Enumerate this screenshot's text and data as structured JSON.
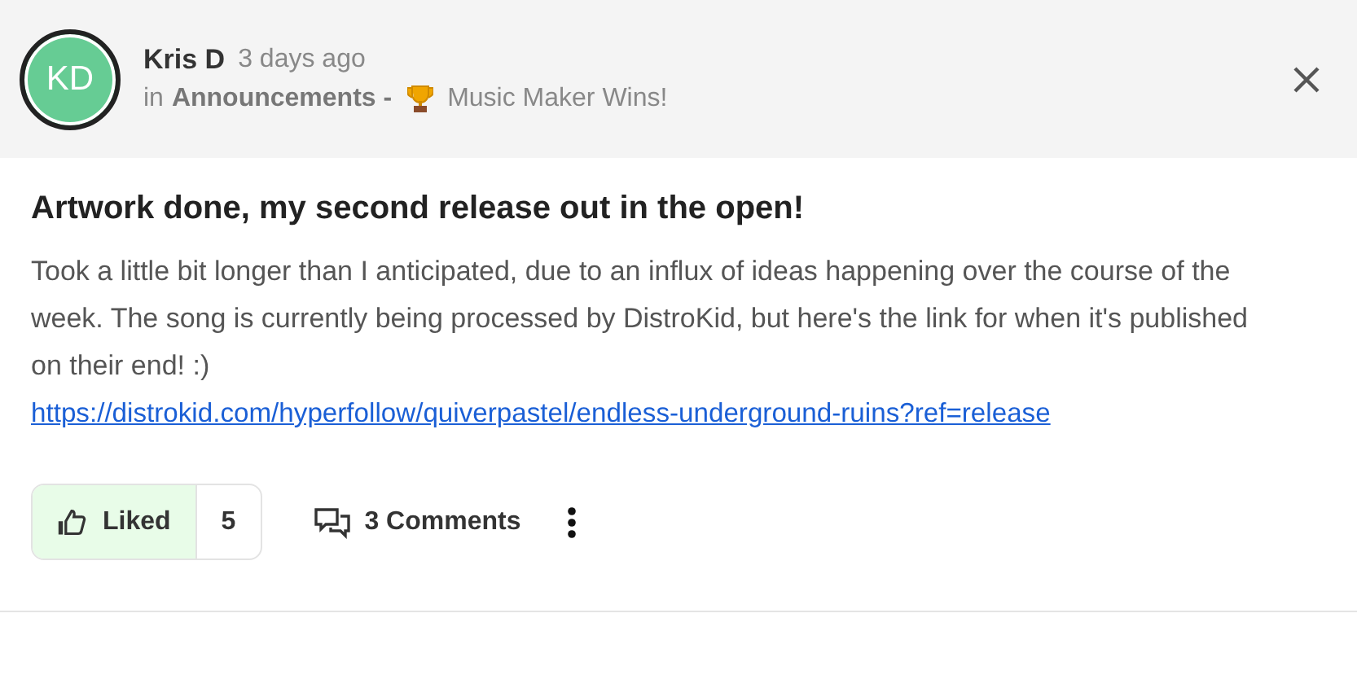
{
  "post": {
    "author": "Kris D",
    "avatar": {
      "initials": "KD",
      "color": "#66cc94"
    },
    "time": "3 days ago",
    "in_label": "in",
    "category": "Announcements -",
    "topic": "Music Maker Wins!",
    "title": "Artwork done, my second release out in the open!",
    "body": "Took a little bit longer than I anticipated, due to an influx of ideas happening over the course of the week. The song is currently being processed by DistroKid, but here's the link for when it's published on their end! :)",
    "link": "https://distrokid.com/hyperfollow/quiverpastel/endless-underground-ruins?ref=release",
    "like": {
      "label": "Liked",
      "liked": true,
      "count": "5"
    },
    "comments": "3 Comments"
  }
}
